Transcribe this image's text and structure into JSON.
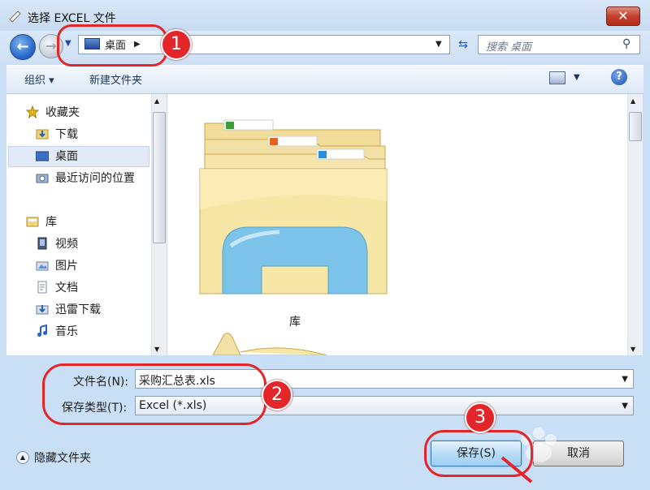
{
  "window": {
    "title": "选择 EXCEL 文件",
    "close_glyph": "✕"
  },
  "nav": {
    "back_glyph": "←",
    "forward_glyph": "→",
    "address_crumb": "桌面",
    "refresh_glyph": "⇆",
    "search_placeholder": "搜索 桌面"
  },
  "toolbar": {
    "organize_label": "组织 ▾",
    "new_folder_label": "新建文件夹",
    "help_glyph": "?"
  },
  "sidebar": {
    "favorites_label": "收藏夹",
    "favorites": [
      {
        "label": "下载",
        "icon": "download-folder-icon"
      },
      {
        "label": "桌面",
        "icon": "desktop-icon",
        "selected": true
      },
      {
        "label": "最近访问的位置",
        "icon": "recent-places-icon"
      }
    ],
    "libraries_label": "库",
    "libraries": [
      {
        "label": "视频",
        "icon": "video-library-icon"
      },
      {
        "label": "图片",
        "icon": "pictures-library-icon"
      },
      {
        "label": "文档",
        "icon": "documents-library-icon"
      },
      {
        "label": "迅雷下载",
        "icon": "thunder-download-icon"
      },
      {
        "label": "音乐",
        "icon": "music-library-icon"
      }
    ]
  },
  "content": {
    "items": [
      {
        "label": "库",
        "icon": "libraries-folder-icon"
      }
    ]
  },
  "form": {
    "filename_label": "文件名(N):",
    "filename_value": "采购汇总表.xls",
    "filetype_label": "保存类型(T):",
    "filetype_value": "Excel (*.xls)"
  },
  "footer": {
    "hide_folders_label": "隐藏文件夹",
    "save_label": "保存(S)",
    "cancel_label": "取消"
  },
  "annotations": {
    "step1": "1",
    "step2": "2",
    "step3": "3",
    "color": "#e3262a"
  },
  "colors": {
    "window_bg": "#c9dff5",
    "accent": "#1f62c7"
  }
}
